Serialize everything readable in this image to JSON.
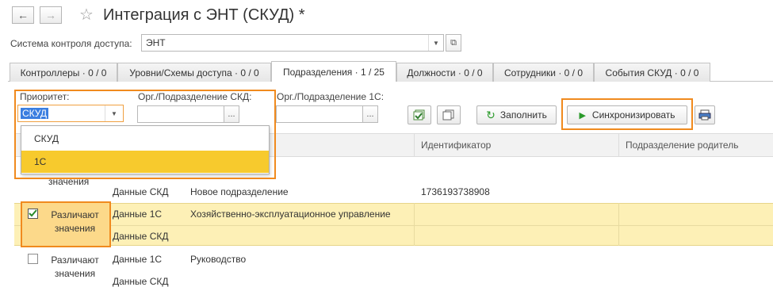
{
  "window": {
    "title": "Интеграция с ЭНТ (СКУД) *",
    "back_icon": "←",
    "forward_icon": "→",
    "star_icon": "☆"
  },
  "access_system": {
    "label": "Система контроля доступа:",
    "value": "ЭНТ"
  },
  "tabs": [
    {
      "label": "Контроллеры · 0 / 0"
    },
    {
      "label": "Уровни/Схемы доступа · 0 / 0"
    },
    {
      "label": "Подразделения · 1 / 25"
    },
    {
      "label": "Должности · 0 / 0"
    },
    {
      "label": "Сотрудники · 0 / 0"
    },
    {
      "label": "События СКУД · 0 / 0"
    }
  ],
  "filters": {
    "priority_label": "Приоритет:",
    "priority_value": "СКУД",
    "org_skud_label": "Орг./Подразделение СКД:",
    "org_1c_label": "Орг./Подразделение 1С:",
    "ellipsis": "..."
  },
  "dropdown": {
    "options": [
      "СКУД",
      "1С"
    ]
  },
  "toolbar": {
    "fill_label": "Заполнить",
    "sync_label": "Синхронизировать"
  },
  "table": {
    "headers": [
      "Идентификатор",
      "Подразделение родитель"
    ],
    "rows": [
      {
        "flag": "значения",
        "sub1": "Данные СКД",
        "name1": "Новое подразделение",
        "id1": "1736193738908"
      },
      {
        "flag": "Различают значения",
        "checked": true,
        "sub1": "Данные 1С",
        "name1": "Хозяйственно-эксплуатационное управление",
        "sub2": "Данные СКД"
      },
      {
        "flag": "Различают значения",
        "checked": false,
        "sub1": "Данные 1С",
        "name1": "Руководство",
        "sub2": "Данные СКД"
      }
    ]
  },
  "colors": {
    "highlight_orange": "#f08a1e",
    "selected_row": "#fdf0b6",
    "dropdown_selected": "#f7ca2d"
  }
}
